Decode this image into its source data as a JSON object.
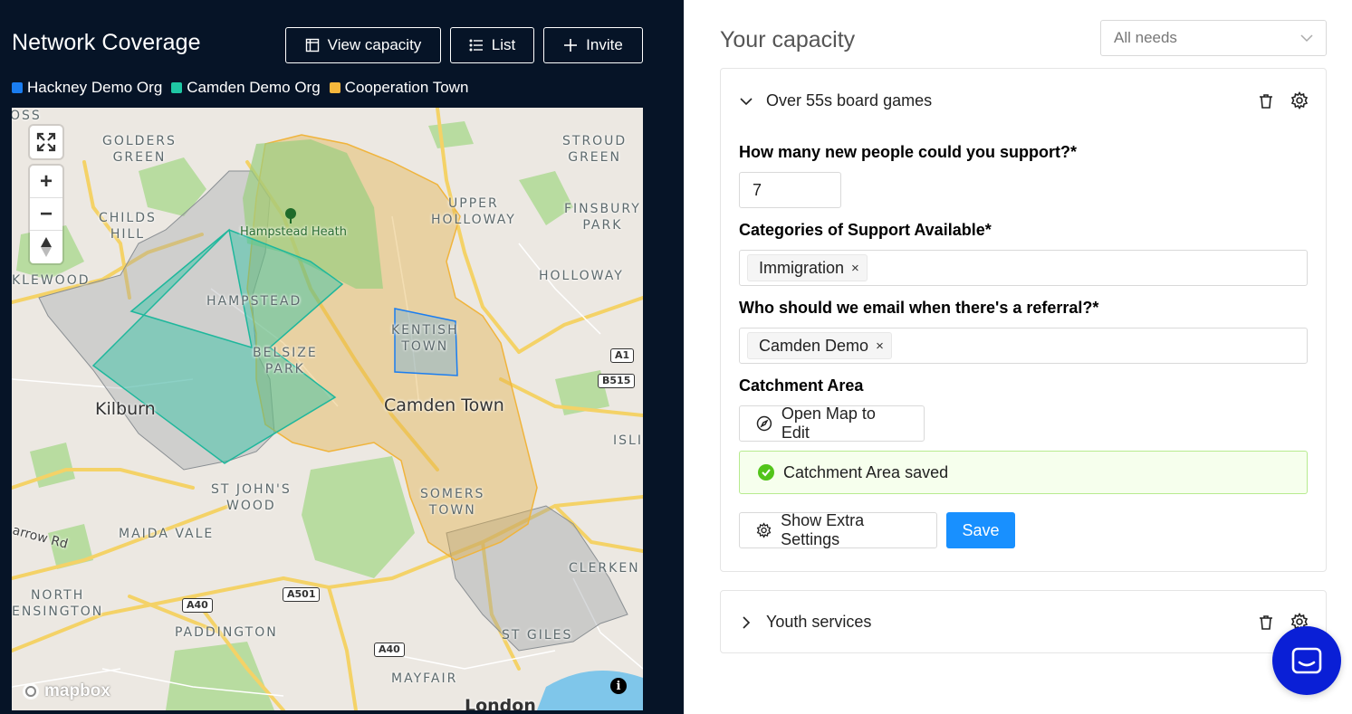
{
  "network": {
    "title": "Network Coverage",
    "buttons": {
      "view_capacity": "View capacity",
      "list": "List",
      "invite": "Invite"
    },
    "legend": [
      {
        "label": "Hackney Demo Org",
        "color": "#1a7df0"
      },
      {
        "label": "Camden Demo Org",
        "color": "#1fc7a4"
      },
      {
        "label": "Cooperation Town",
        "color": "#f6b73c"
      }
    ]
  },
  "map": {
    "labels": {
      "oss": "OSS",
      "golders_green": "GOLDERS\nGREEN",
      "stroud_green": "STROUD\nGREEN",
      "upper_holloway": "UPPER\nHOLLOWAY",
      "finsbury_park": "FINSBURY\nPARK",
      "childs_hill": "CHILDS\nHILL",
      "hampstead_heath": "Hampstead Heath",
      "holloway": "HOLLOWAY",
      "klewood": "KLEWOOD",
      "hampstead": "HAMPSTEAD",
      "kentish_town": "KENTISH\nTOWN",
      "belsize_park": "BELSIZE\nPARK",
      "kilburn": "Kilburn",
      "camden_town": "Camden Town",
      "isli": "ISLI",
      "st_johns_wood": "ST JOHN'S\nWOOD",
      "somers_town": "SOMERS\nTOWN",
      "maida_vale": "MAIDA VALE",
      "harrow_rd": "arrow Rd",
      "clerken": "CLERKEN",
      "north_kensington": "NORTH\nENSINGTON",
      "paddington": "PADDINGTON",
      "st_giles": "ST GILES",
      "mayfair": "MAYFAIR",
      "london": "London"
    },
    "shields": {
      "a1": "A1",
      "b515": "B515",
      "a501": "A501",
      "a40_left": "A40",
      "a40_mid": "A40"
    },
    "controls": {
      "zoom_in": "+",
      "zoom_out": "−"
    },
    "attribution": "mapbox",
    "info": "i"
  },
  "capacity": {
    "title": "Your capacity",
    "filter_value": "All needs",
    "cards": [
      {
        "title": "Over 55s board games",
        "expanded": true,
        "fields": {
          "support_label": "How many new people could you support?*",
          "support_value": "7",
          "categories_label": "Categories of Support Available*",
          "categories_tags": [
            "Immigration"
          ],
          "email_label": "Who should we email when there's a referral?*",
          "email_tags": [
            "Camden Demo"
          ],
          "catchment_label": "Catchment Area",
          "open_map_label": "Open Map to Edit",
          "saved_message": "Catchment Area saved",
          "extra_settings_label": "Show Extra Settings",
          "save_label": "Save"
        }
      },
      {
        "title": "Youth services",
        "expanded": false
      }
    ]
  },
  "tag_remove": "×"
}
